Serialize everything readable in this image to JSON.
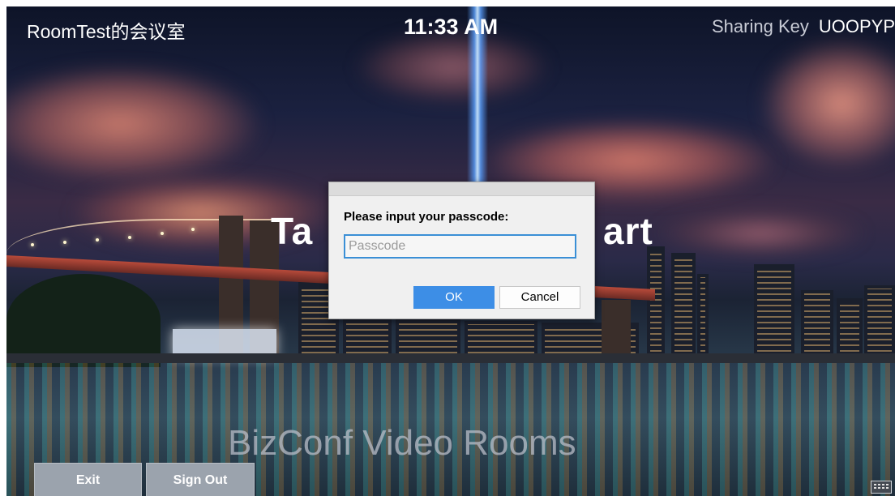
{
  "header": {
    "room_name": "RoomTest的会议室",
    "time": "11:33 AM",
    "sharing_key_label": "Sharing Key",
    "sharing_key_value": "UOOPYP"
  },
  "main": {
    "tap_to_start_left": "Ta",
    "tap_to_start_right": "art",
    "brand_text": "BizConf Video Rooms"
  },
  "footer": {
    "exit_label": "Exit",
    "sign_out_label": "Sign Out"
  },
  "dialog": {
    "prompt": "Please input your passcode:",
    "placeholder": "Passcode",
    "value": "",
    "ok_label": "OK",
    "cancel_label": "Cancel"
  },
  "colors": {
    "accent": "#3d8ee6",
    "button_gray": "#9ba3ad"
  }
}
